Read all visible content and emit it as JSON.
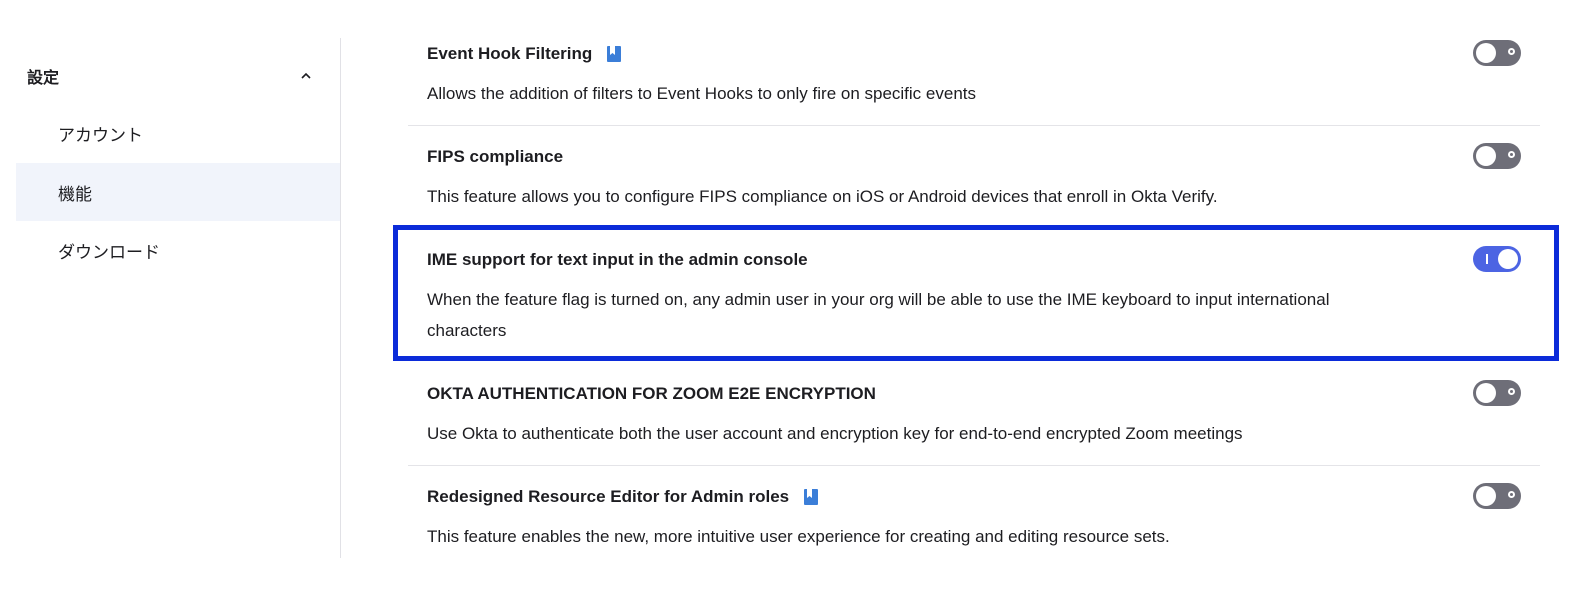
{
  "sidebar": {
    "title": "設定",
    "items": [
      {
        "label": "アカウント"
      },
      {
        "label": "機能"
      },
      {
        "label": "ダウンロード"
      }
    ]
  },
  "features": [
    {
      "title": "Event Hook Filtering",
      "description": "Allows the addition of filters to Event Hooks to only fire on specific events",
      "enabled": false,
      "doc_icon": true
    },
    {
      "title": "FIPS compliance",
      "description": "This feature allows you to configure FIPS compliance on iOS or Android devices that enroll in Okta Verify.",
      "enabled": false,
      "doc_icon": false
    },
    {
      "title": "IME support for text input in the admin console",
      "description": "When the feature flag is turned on, any admin user in your org will be able to use the IME keyboard to input international characters",
      "enabled": true,
      "doc_icon": false
    },
    {
      "title": "OKTA AUTHENTICATION FOR ZOOM E2E ENCRYPTION",
      "description": "Use Okta to authenticate both the user account and encryption key for end-to-end encrypted Zoom meetings",
      "enabled": false,
      "doc_icon": false
    },
    {
      "title": "Redesigned Resource Editor for Admin roles",
      "description": "This feature enables the new, more intuitive user experience for creating and editing resource sets.",
      "enabled": false,
      "doc_icon": true
    }
  ],
  "colors": {
    "toggle_on": "#4c64e3",
    "toggle_off": "#6e6e78",
    "highlight_border": "#0b2bd9",
    "active_nav_bg": "#f1f4fb"
  }
}
